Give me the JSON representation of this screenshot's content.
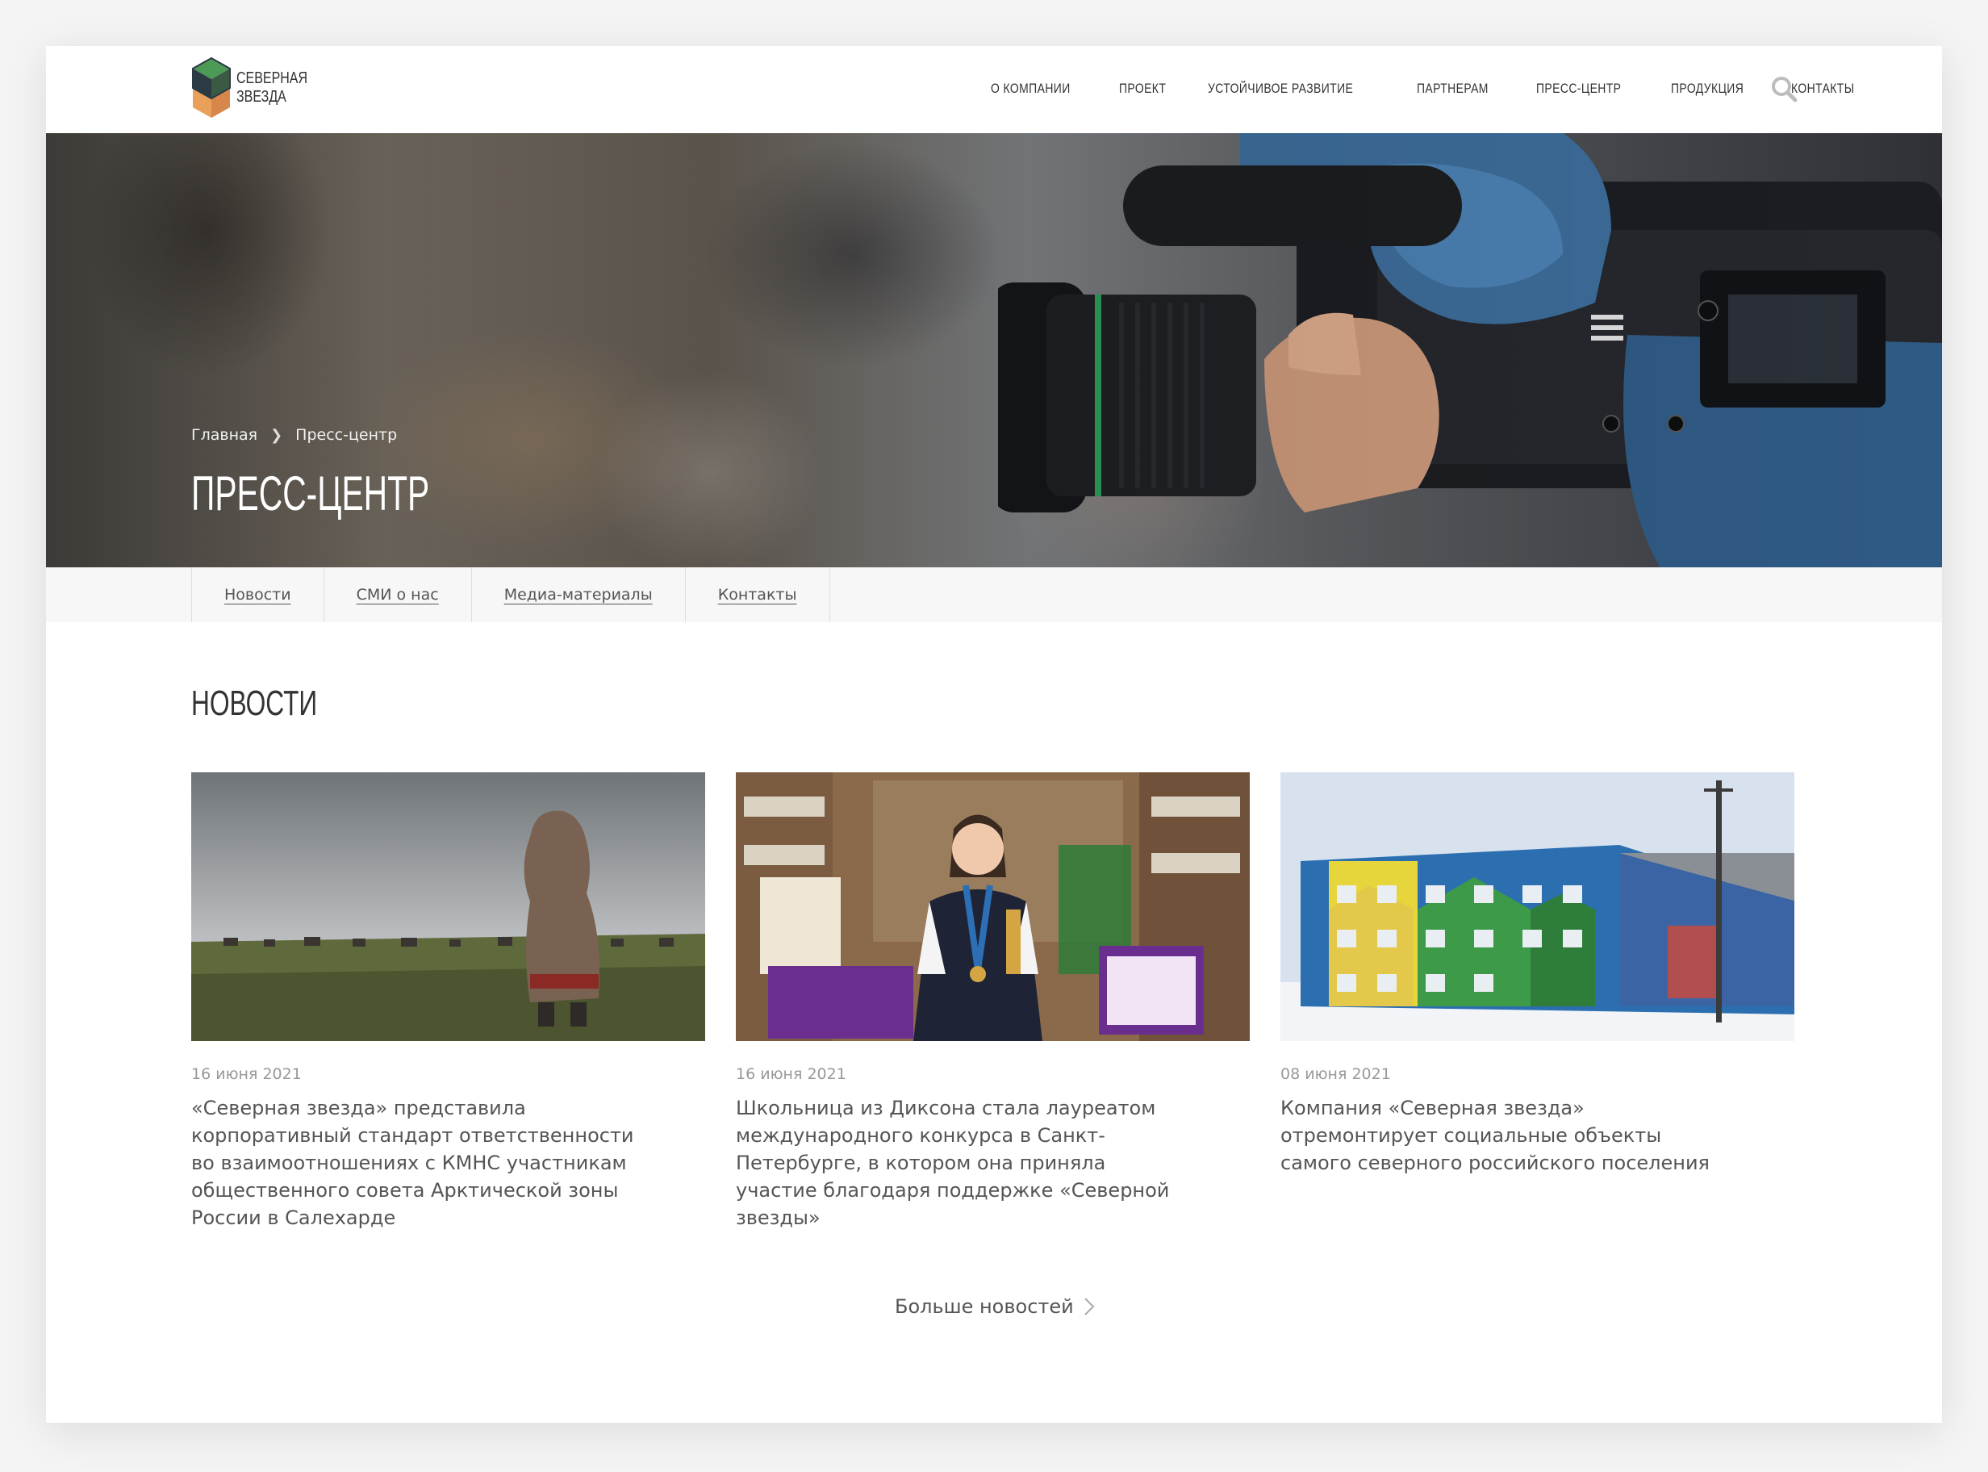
{
  "brand": {
    "logo_line1": "Северная",
    "logo_line2": "звезда"
  },
  "nav": {
    "items": [
      {
        "label": "О компании"
      },
      {
        "label": "Проект"
      },
      {
        "label": "Устойчивое развитие"
      },
      {
        "label": "Партнерам"
      },
      {
        "label": "Пресс-центр"
      },
      {
        "label": "Продукция"
      },
      {
        "label": "Контакты"
      }
    ],
    "search_icon": "search-icon"
  },
  "hero": {
    "breadcrumb": {
      "home": "Главная",
      "current": "Пресс-центр"
    },
    "title": "Пресс-центр"
  },
  "subnav": {
    "items": [
      {
        "label": "Новости"
      },
      {
        "label": "СМИ о нас"
      },
      {
        "label": "Медиа-материалы"
      },
      {
        "label": "Контакты"
      }
    ]
  },
  "news": {
    "title": "Новости",
    "cards": [
      {
        "date": "16 июня 2021",
        "title": "«Северная звезда» представила корпоративный стандарт ответственности во взаимоотношениях с КМНС участникам общественного совета Арктической зоны России в Салехарде"
      },
      {
        "date": "16 июня 2021",
        "title": "Школьница из Диксона стала лауреатом международного конкурса в Санкт-Петербурге, в котором она приняла участие благодаря поддержке «Северной звезды»"
      },
      {
        "date": "08 июня 2021",
        "title": "Компания «Северная звезда» отремонтирует социальные объекты самого северного российского поселения"
      }
    ],
    "more_label": "Больше новостей"
  },
  "colors": {
    "logo_green": "#3f8a4b",
    "logo_orange": "#e8a05a",
    "logo_dark": "#2b3a45",
    "text": "#555555",
    "muted": "#999999"
  }
}
